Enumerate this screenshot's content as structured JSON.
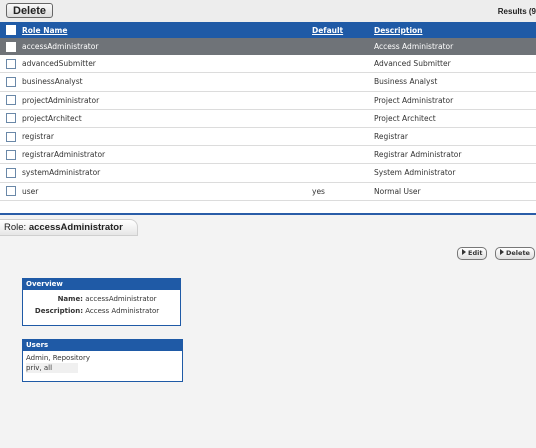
{
  "toolbar": {
    "delete_label": "Delete",
    "results_text": "Results (9"
  },
  "table": {
    "headers": {
      "name": "Role Name",
      "default": "Default",
      "description": "Description"
    },
    "rows": [
      {
        "name": "accessAdministrator",
        "default": "",
        "description": "Access Administrator",
        "selected": true
      },
      {
        "name": "advancedSubmitter",
        "default": "",
        "description": "Advanced Submitter"
      },
      {
        "name": "businessAnalyst",
        "default": "",
        "description": "Business Analyst"
      },
      {
        "name": "projectAdministrator",
        "default": "",
        "description": "Project Administrator"
      },
      {
        "name": "projectArchitect",
        "default": "",
        "description": "Project Architect"
      },
      {
        "name": "registrar",
        "default": "",
        "description": "Registrar"
      },
      {
        "name": "registrarAdministrator",
        "default": "",
        "description": "Registrar Administrator"
      },
      {
        "name": "systemAdministrator",
        "default": "",
        "description": "System Administrator"
      },
      {
        "name": "user",
        "default": "yes",
        "description": "Normal User"
      }
    ]
  },
  "detail": {
    "role_prefix": "Role: ",
    "role_name": "accessAdministrator",
    "edit_label": "Edit",
    "delete_label": "Delete",
    "overview": {
      "title": "Overview",
      "name_key": "Name:",
      "name_value": "accessAdministrator",
      "desc_key": "Description:",
      "desc_value": "Access Administrator"
    },
    "users": {
      "title": "Users",
      "line1": "Admin, Repository",
      "line2": "priv, all"
    }
  },
  "colors": {
    "header_blue": "#1f5aa6",
    "selected_row": "#6f7378"
  }
}
